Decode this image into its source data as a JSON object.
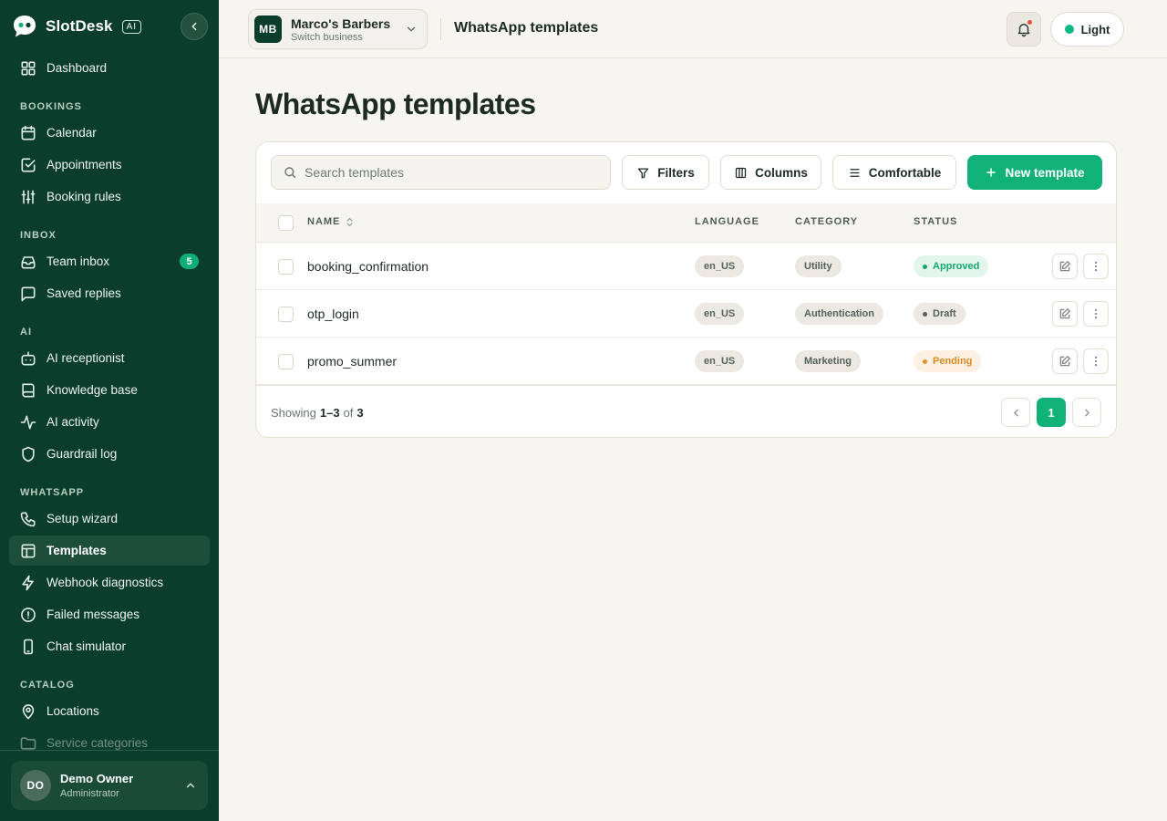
{
  "brand": {
    "name": "SlotDesk",
    "badge": "AI"
  },
  "sidebar": {
    "top_item": {
      "label": "Dashboard",
      "icon": "grid-icon"
    },
    "sections": [
      {
        "title": "BOOKINGS",
        "items": [
          {
            "label": "Calendar",
            "icon": "calendar-icon"
          },
          {
            "label": "Appointments",
            "icon": "clipboard-check-icon"
          },
          {
            "label": "Booking rules",
            "icon": "sliders-icon"
          }
        ]
      },
      {
        "title": "INBOX",
        "items": [
          {
            "label": "Team inbox",
            "icon": "inbox-icon",
            "badge": "5"
          },
          {
            "label": "Saved replies",
            "icon": "message-square-icon"
          }
        ]
      },
      {
        "title": "AI",
        "items": [
          {
            "label": "AI receptionist",
            "icon": "bot-icon"
          },
          {
            "label": "Knowledge base",
            "icon": "book-icon"
          },
          {
            "label": "AI activity",
            "icon": "activity-icon"
          },
          {
            "label": "Guardrail log",
            "icon": "shield-icon"
          }
        ]
      },
      {
        "title": "WHATSAPP",
        "items": [
          {
            "label": "Setup wizard",
            "icon": "phone-icon"
          },
          {
            "label": "Templates",
            "icon": "layout-template-icon",
            "active": true
          },
          {
            "label": "Webhook diagnostics",
            "icon": "zap-icon"
          },
          {
            "label": "Failed messages",
            "icon": "alert-circle-icon"
          },
          {
            "label": "Chat simulator",
            "icon": "smartphone-icon"
          }
        ]
      },
      {
        "title": "CATALOG",
        "items": [
          {
            "label": "Locations",
            "icon": "map-pin-icon"
          },
          {
            "label": "Service categories",
            "icon": "folder-icon"
          }
        ]
      }
    ]
  },
  "user": {
    "initials": "DO",
    "name": "Demo Owner",
    "role": "Administrator"
  },
  "topbar": {
    "business": {
      "initials": "MB",
      "name": "Marco's Barbers",
      "subtitle": "Switch business"
    },
    "title": "WhatsApp templates",
    "theme_label": "Light",
    "theme_color": "#10b981"
  },
  "main": {
    "title": "WhatsApp templates",
    "search_placeholder": "Search templates",
    "toolbar": {
      "filters": "Filters",
      "columns": "Columns",
      "density": "Comfortable",
      "new_template": "New template"
    },
    "table": {
      "headers": {
        "name": "NAME",
        "language": "LANGUAGE",
        "category": "CATEGORY",
        "status": "STATUS"
      },
      "rows": [
        {
          "name": "booking_confirmation",
          "language": "en_US",
          "category": "Utility",
          "status": "Approved",
          "status_kind": "approved"
        },
        {
          "name": "otp_login",
          "language": "en_US",
          "category": "Authentication",
          "status": "Draft",
          "status_kind": "draft"
        },
        {
          "name": "promo_summer",
          "language": "en_US",
          "category": "Marketing",
          "status": "Pending",
          "status_kind": "pending"
        }
      ]
    },
    "pagination": {
      "showing_label": "Showing",
      "range": "1–3",
      "of_label": "of",
      "total": "3",
      "current_page": "1"
    }
  },
  "colors": {
    "sidebar_bg": "#0b3d2c",
    "accent": "#10b27a",
    "page_bg": "#f7f5f0"
  }
}
